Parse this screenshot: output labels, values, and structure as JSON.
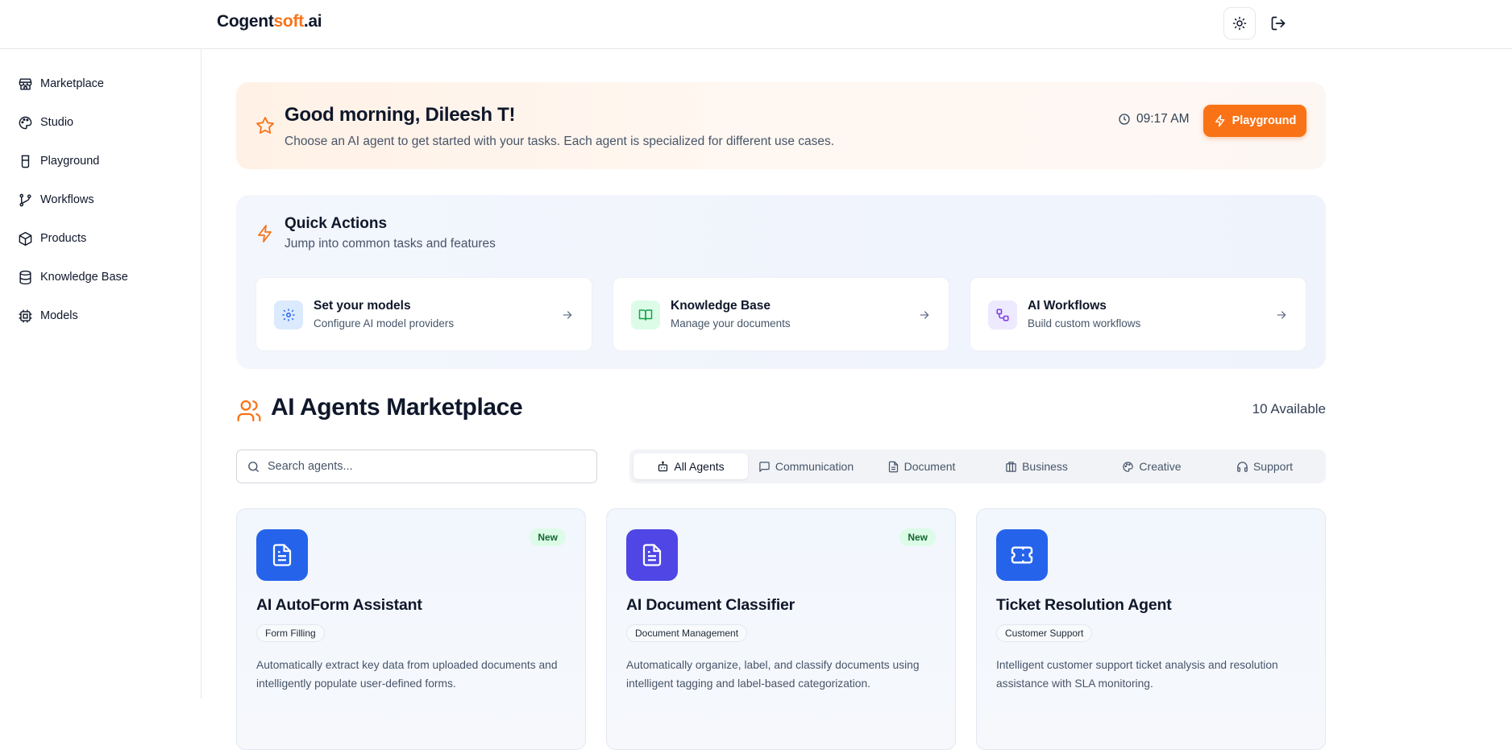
{
  "header": {
    "logo_part1": "Cogent",
    "logo_part2": "soft",
    "logo_part3": ".ai",
    "icons": [
      "sun-icon",
      "logout-icon"
    ]
  },
  "sidebar": {
    "items": [
      {
        "label": "Marketplace",
        "icon": "store-icon"
      },
      {
        "label": "Studio",
        "icon": "palette-icon"
      },
      {
        "label": "Playground",
        "icon": "beaker-icon"
      },
      {
        "label": "Workflows",
        "icon": "git-branch-icon"
      },
      {
        "label": "Products",
        "icon": "package-icon"
      },
      {
        "label": "Knowledge Base",
        "icon": "database-icon"
      },
      {
        "label": "Models",
        "icon": "cpu-icon"
      }
    ]
  },
  "greeting": {
    "title": "Good morning, Dileesh T!",
    "subtitle": "Choose an AI agent to get started with your tasks. Each agent is specialized for different use cases.",
    "time": "09:17 AM",
    "button_label": "Playground"
  },
  "quick_actions": {
    "title": "Quick Actions",
    "subtitle": "Jump into common tasks and features",
    "cards": [
      {
        "title": "Set your models",
        "subtitle": "Configure AI model providers",
        "icon": "settings-icon"
      },
      {
        "title": "Knowledge Base",
        "subtitle": "Manage your documents",
        "icon": "book-open-icon"
      },
      {
        "title": "AI Workflows",
        "subtitle": "Build custom workflows",
        "icon": "workflow-icon"
      }
    ]
  },
  "marketplace": {
    "title": "AI Agents Marketplace",
    "count": "10 Available",
    "search_placeholder": "Search agents...",
    "tabs": [
      {
        "label": "All Agents",
        "icon": "bot-icon",
        "active": true
      },
      {
        "label": "Communication",
        "icon": "message-icon",
        "active": false
      },
      {
        "label": "Document",
        "icon": "file-icon",
        "active": false
      },
      {
        "label": "Business",
        "icon": "building-icon",
        "active": false
      },
      {
        "label": "Creative",
        "icon": "palette-icon",
        "active": false
      },
      {
        "label": "Support",
        "icon": "headphones-icon",
        "active": false
      }
    ],
    "agents": [
      {
        "name": "AI AutoForm Assistant",
        "badge": "New",
        "category": "Form Filling",
        "description": "Automatically extract key data from uploaded documents and intelligently populate user-defined forms.",
        "icon": "file-text-icon",
        "color": "#2563eb"
      },
      {
        "name": "AI Document Classifier",
        "badge": "New",
        "category": "Document Management",
        "description": "Automatically organize, label, and classify documents using intelligent tagging and label-based categorization.",
        "icon": "file-text-icon",
        "color": "#4f46e5"
      },
      {
        "name": "Ticket Resolution Agent",
        "badge": "",
        "category": "Customer Support",
        "description": "Intelligent customer support ticket analysis and resolution assistance with SLA monitoring.",
        "icon": "ticket-icon",
        "color": "#2563eb"
      }
    ]
  },
  "colors": {
    "accent": "#f97316",
    "text": "#0f172a",
    "muted": "#475569"
  }
}
